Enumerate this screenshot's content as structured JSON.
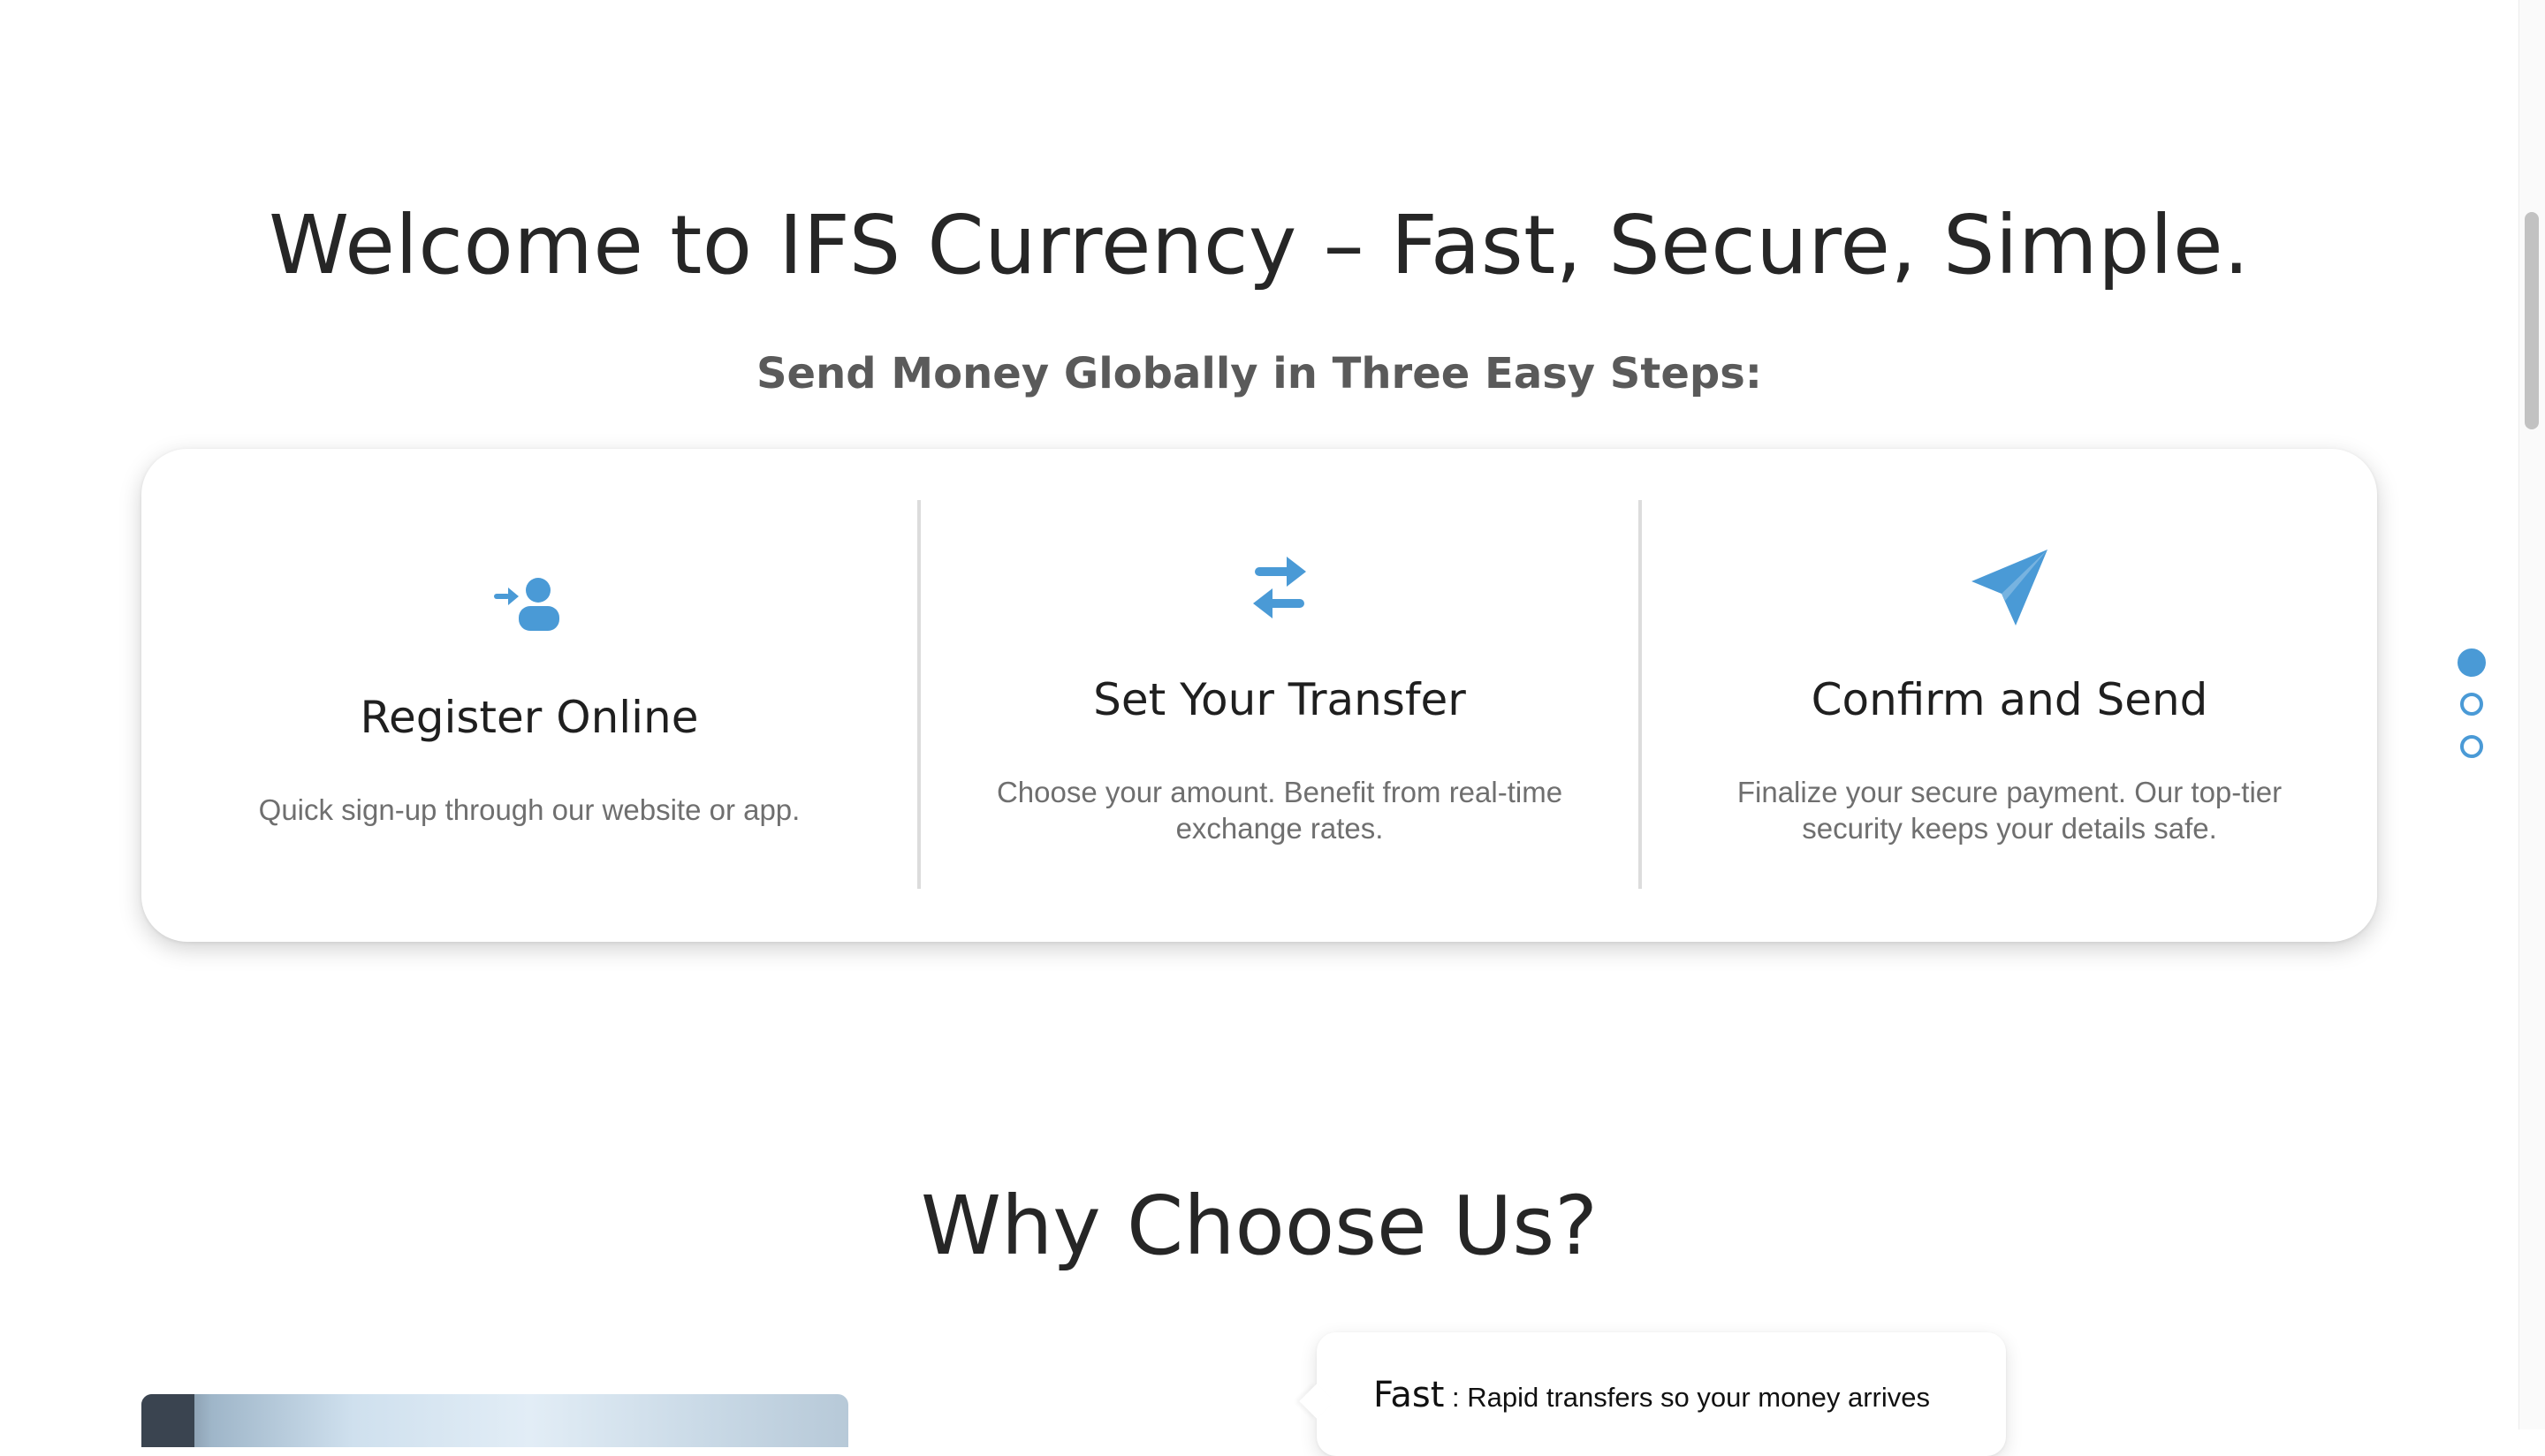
{
  "intro": {
    "title": "Welcome to IFS Currency – Fast, Secure, Simple.",
    "subtitle": "Send Money Globally in Three Easy Steps:"
  },
  "steps": [
    {
      "icon": "user-plus-icon",
      "title": "Register Online",
      "description": "Quick sign-up through our website or app."
    },
    {
      "icon": "transfer-arrows-icon",
      "title": "Set Your Transfer",
      "description": "Choose your amount. Benefit from real-time exchange rates."
    },
    {
      "icon": "paper-plane-icon",
      "title": "Confirm and Send",
      "description": "Finalize your secure payment. Our top-tier security keeps your details safe."
    }
  ],
  "colors": {
    "accent": "#4a9ad6",
    "heading": "#262626",
    "muted_text": "#6f6f6f"
  },
  "slider_nav": {
    "count": 3,
    "active_index": 0
  },
  "why_us": {
    "title": "Why Choose Us?",
    "features": [
      {
        "name": "Fast",
        "separator": " : ",
        "description": "Rapid transfers so your money arrives"
      }
    ]
  }
}
